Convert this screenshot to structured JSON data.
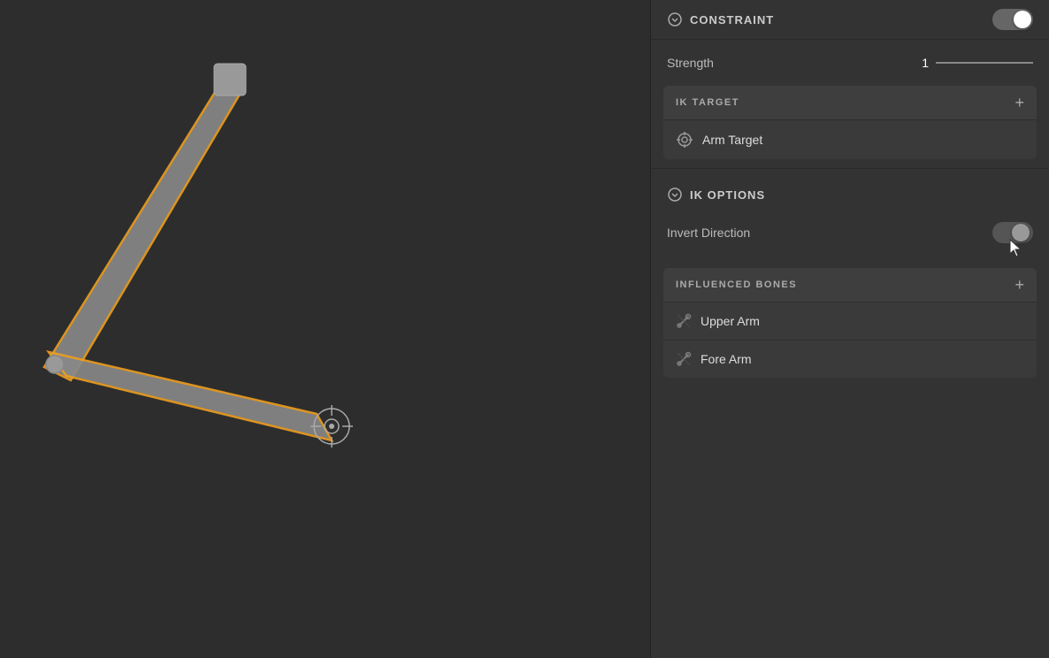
{
  "canvas": {
    "background": "#2d2d2d"
  },
  "panel": {
    "constraint": {
      "title": "CONSTRAINT",
      "toggle_active": true
    },
    "strength": {
      "label": "Strength",
      "value": "1"
    },
    "ik_target": {
      "section_title": "IK TARGET",
      "plus_icon": "+",
      "item_label": "Arm Target"
    },
    "ik_options": {
      "section_title": "IK OPTIONS",
      "invert_direction": {
        "label": "Invert Direction"
      }
    },
    "influenced_bones": {
      "section_title": "INFLUENCED BONES",
      "plus_icon": "+",
      "items": [
        {
          "label": "Upper Arm"
        },
        {
          "label": "Fore Arm"
        }
      ]
    }
  }
}
